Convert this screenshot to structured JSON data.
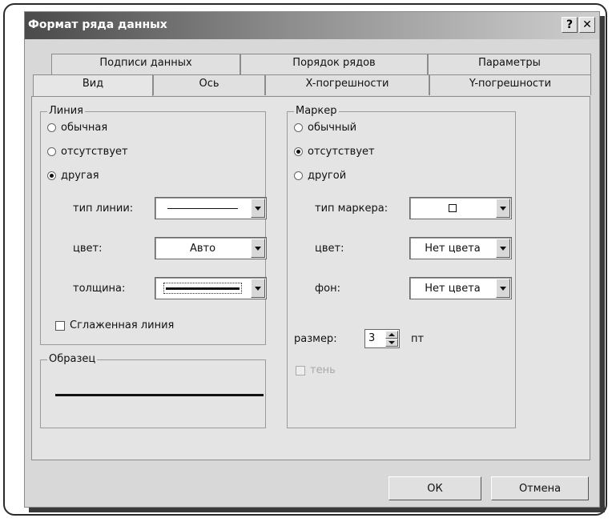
{
  "dialog": {
    "title": "Формат ряда данных",
    "help_button": "?",
    "close_button": "✕"
  },
  "tabs_top": [
    "Подписи данных",
    "Порядок рядов",
    "Параметры"
  ],
  "tabs_bottom": [
    "Вид",
    "Ось",
    "X-погрешности",
    "Y-погрешности"
  ],
  "line": {
    "legend": "Линия",
    "options": [
      "обычная",
      "отсутствует",
      "другая"
    ],
    "selected": "другая",
    "type_label": "тип линии:",
    "color_label": "цвет:",
    "color_value": "Авто",
    "weight_label": "толщина:",
    "smooth_label": "Сглаженная линия"
  },
  "marker": {
    "legend": "Маркер",
    "options": [
      "обычный",
      "отсутствует",
      "другой"
    ],
    "selected": "отсутствует",
    "type_label": "тип маркера:",
    "color_label": "цвет:",
    "color_value": "Нет цвета",
    "fill_label": "фон:",
    "fill_value": "Нет цвета",
    "size_label": "размер:",
    "size_value": "3",
    "size_unit": "пт",
    "shadow_label": "тень"
  },
  "sample": {
    "legend": "Образец"
  },
  "buttons": {
    "ok": "ОК",
    "cancel": "Отмена"
  }
}
